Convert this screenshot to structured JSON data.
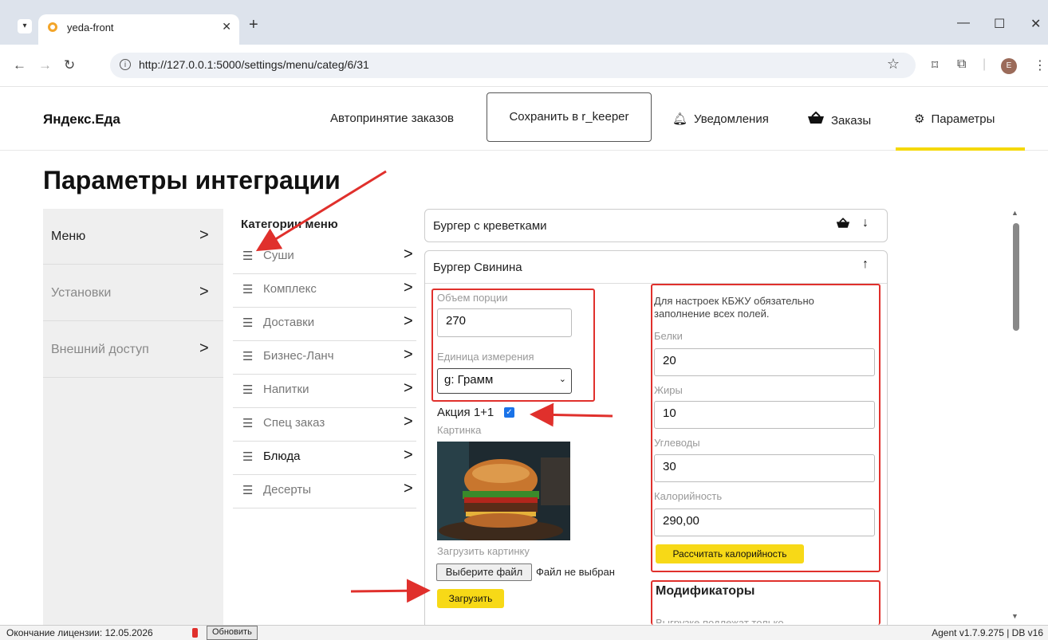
{
  "browser": {
    "tab_title": "yeda-front",
    "url": "http://127.0.0.1:5000/settings/menu/categ/6/31",
    "profile_initial": "E"
  },
  "header": {
    "brand": "Яндекс.Еда",
    "auto_accept": "Автопринятие заказов",
    "save_rkeeper": "Сохранить в r_keeper",
    "notifications": "Уведомления",
    "orders": "Заказы",
    "params": "Параметры"
  },
  "page_title": "Параметры интеграции",
  "sidebar": {
    "items": [
      {
        "label": "Меню"
      },
      {
        "label": "Установки"
      },
      {
        "label": "Внешний доступ"
      }
    ]
  },
  "categories": {
    "title": "Категории меню",
    "items": [
      {
        "label": "Суши"
      },
      {
        "label": "Комплекс"
      },
      {
        "label": "Доставки"
      },
      {
        "label": "Бизнес-Ланч"
      },
      {
        "label": "Напитки"
      },
      {
        "label": "Спец заказ"
      },
      {
        "label": "Блюда"
      },
      {
        "label": "Десерты"
      }
    ]
  },
  "products": {
    "p1": {
      "name": "Бургер с креветками"
    },
    "p2": {
      "name": "Бургер Свинина",
      "portion_label": "Объем порции",
      "portion_value": "270",
      "unit_label": "Единица измерения",
      "unit_value": "g: Грамм",
      "promo_label": "Акция 1+1",
      "picture_label": "Картинка",
      "upload_label": "Загрузить картинку",
      "choose_file": "Выберите файл",
      "no_file": "Файл не выбран",
      "upload_button": "Загрузить",
      "kbju_note": "Для настроек КБЖУ обязательно заполнение всех полей.",
      "protein_label": "Белки",
      "protein_value": "20",
      "fat_label": "Жиры",
      "fat_value": "10",
      "carbs_label": "Углеводы",
      "carbs_value": "30",
      "calories_label": "Калорийность",
      "calories_value": "290,00",
      "calc_button": "Рассчитать калорийность",
      "modifiers_title": "Модификаторы",
      "modifiers_note": "Выгрузке подлежат только"
    }
  },
  "statusbar": {
    "license": "Окончание лицензии: 12.05.2026",
    "refresh": "Обновить",
    "version": "Agent v1.7.9.275  |  DB v16"
  },
  "colors": {
    "accent_yellow": "#f7d917",
    "annotation_red": "#e0302c"
  }
}
